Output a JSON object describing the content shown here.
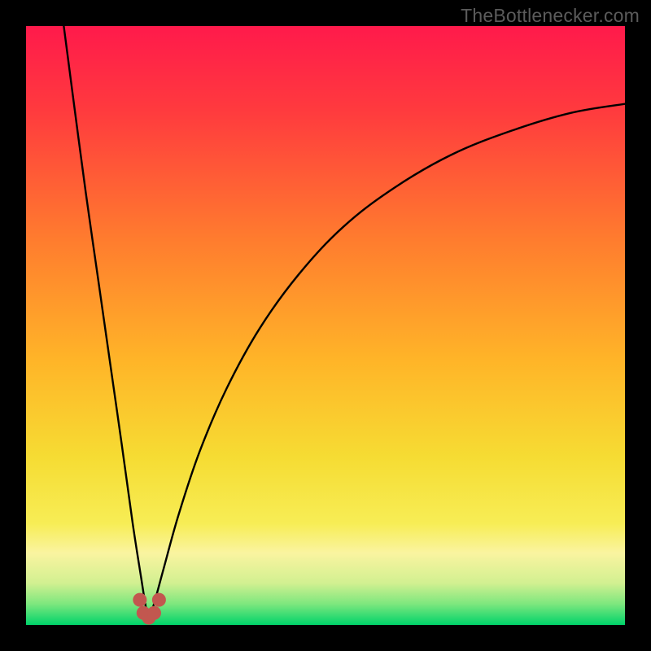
{
  "attribution": "TheBottlenecker.com",
  "colors": {
    "frame": "#000000",
    "grad_top": "#ff1a4b",
    "grad_mid1": "#ff5535",
    "grad_mid2": "#ffb024",
    "grad_mid3": "#f7e338",
    "grad_band": "#faf59b",
    "grad_bottom": "#00d86b",
    "curve": "#000000",
    "marker": "#c2574f"
  },
  "frame": {
    "inset": 32,
    "size": 800
  },
  "chart_data": {
    "type": "line",
    "title": "",
    "xlabel": "",
    "ylabel": "",
    "xlim": [
      0,
      1
    ],
    "ylim": [
      0,
      1
    ],
    "valley_x": 0.205,
    "curve_left": {
      "comment": "Left branch: steep descent from top-left to the valley",
      "points": [
        {
          "x": 0.063,
          "y": 1.0
        },
        {
          "x": 0.08,
          "y": 0.87
        },
        {
          "x": 0.1,
          "y": 0.72
        },
        {
          "x": 0.12,
          "y": 0.58
        },
        {
          "x": 0.14,
          "y": 0.44
        },
        {
          "x": 0.16,
          "y": 0.3
        },
        {
          "x": 0.178,
          "y": 0.17
        },
        {
          "x": 0.192,
          "y": 0.08
        },
        {
          "x": 0.2,
          "y": 0.03
        },
        {
          "x": 0.205,
          "y": 0.01
        }
      ]
    },
    "curve_right": {
      "comment": "Right branch: starts at valley, rises with decreasing slope toward ~0.87 at x=1",
      "points": [
        {
          "x": 0.205,
          "y": 0.01
        },
        {
          "x": 0.215,
          "y": 0.04
        },
        {
          "x": 0.23,
          "y": 0.095
        },
        {
          "x": 0.255,
          "y": 0.185
        },
        {
          "x": 0.29,
          "y": 0.29
        },
        {
          "x": 0.335,
          "y": 0.395
        },
        {
          "x": 0.39,
          "y": 0.495
        },
        {
          "x": 0.455,
          "y": 0.585
        },
        {
          "x": 0.53,
          "y": 0.665
        },
        {
          "x": 0.615,
          "y": 0.73
        },
        {
          "x": 0.71,
          "y": 0.785
        },
        {
          "x": 0.81,
          "y": 0.825
        },
        {
          "x": 0.91,
          "y": 0.855
        },
        {
          "x": 1.0,
          "y": 0.87
        }
      ]
    },
    "markers": [
      {
        "x": 0.19,
        "y": 0.042
      },
      {
        "x": 0.196,
        "y": 0.02
      },
      {
        "x": 0.205,
        "y": 0.012
      },
      {
        "x": 0.214,
        "y": 0.02
      },
      {
        "x": 0.222,
        "y": 0.042
      }
    ],
    "gradient_stops": [
      {
        "offset": 0.0,
        "color": "#ff1a4b"
      },
      {
        "offset": 0.14,
        "color": "#ff3a3e"
      },
      {
        "offset": 0.36,
        "color": "#ff7d2e"
      },
      {
        "offset": 0.56,
        "color": "#ffb528"
      },
      {
        "offset": 0.72,
        "color": "#f6dc33"
      },
      {
        "offset": 0.83,
        "color": "#f7ed55"
      },
      {
        "offset": 0.88,
        "color": "#faf4a0"
      },
      {
        "offset": 0.93,
        "color": "#d2f091"
      },
      {
        "offset": 0.965,
        "color": "#7de77e"
      },
      {
        "offset": 1.0,
        "color": "#00d36a"
      }
    ]
  }
}
